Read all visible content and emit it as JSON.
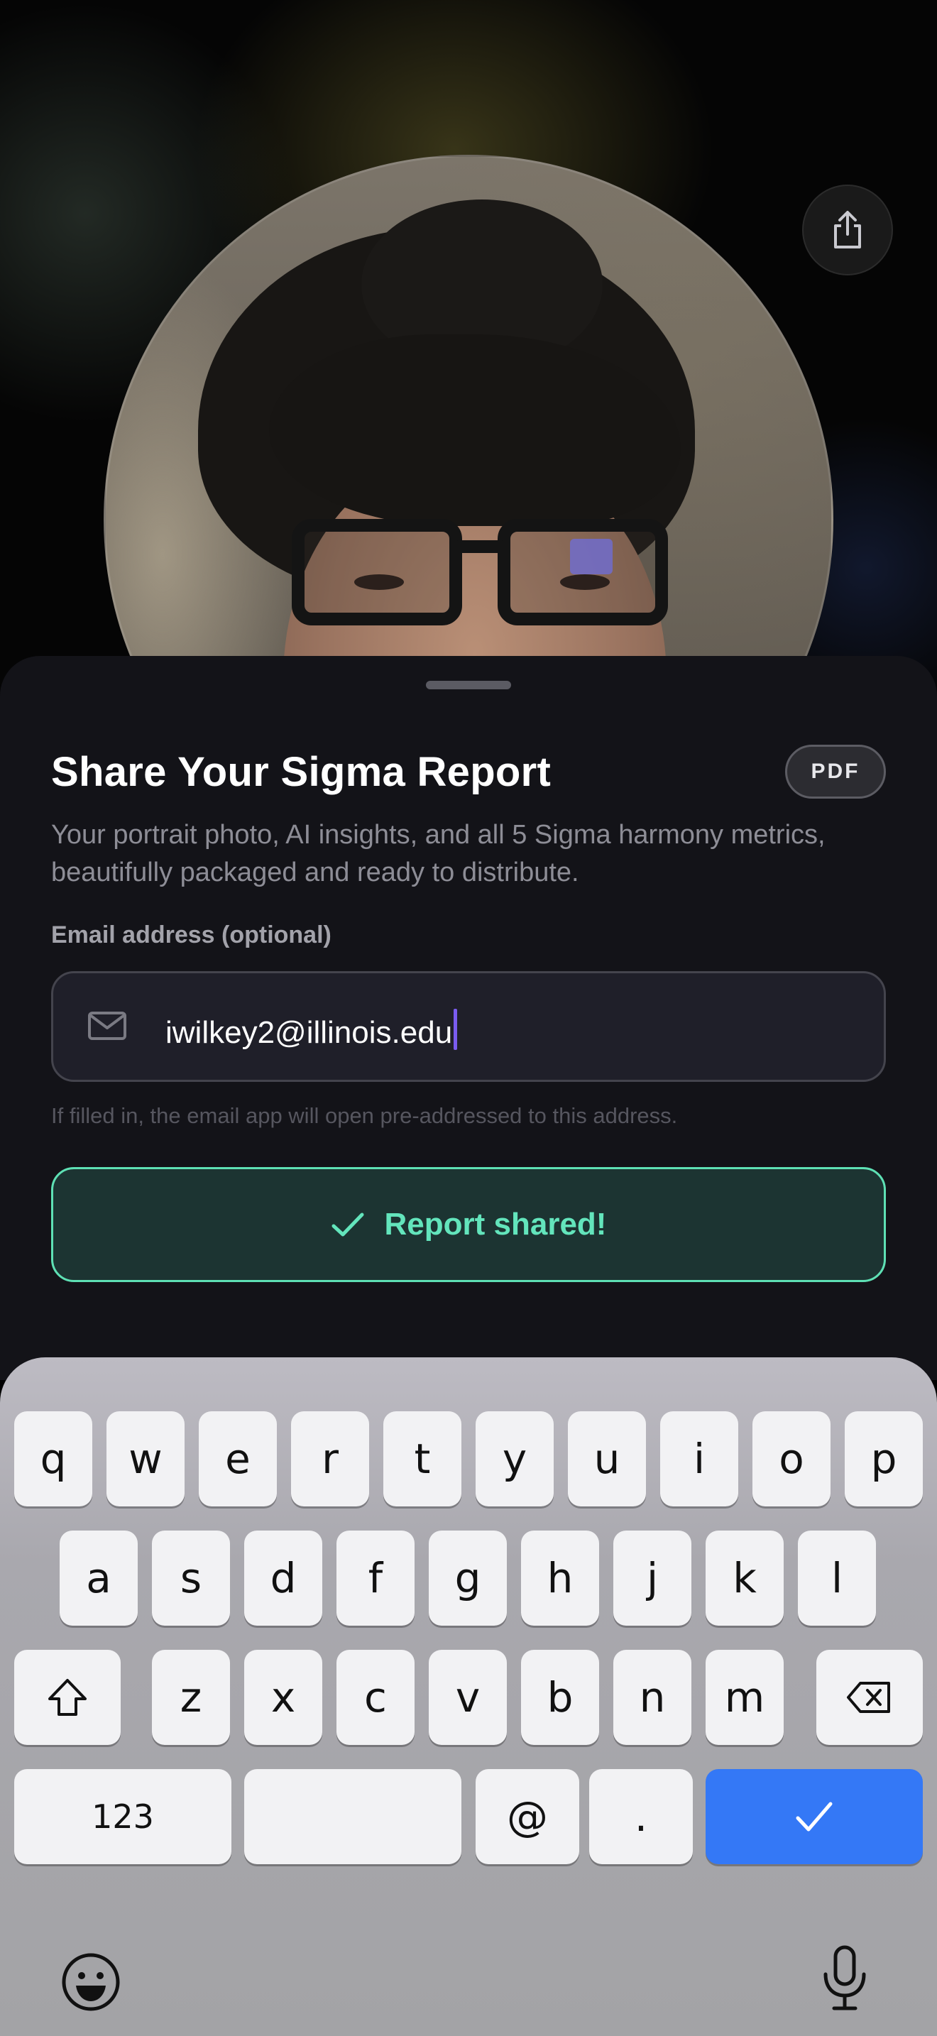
{
  "share_icon": "share-icon",
  "sheet": {
    "title": "Share Your Sigma Report",
    "badge": "PDF",
    "description": "Your portrait photo, AI insights, and all 5 Sigma harmony metrics, beautifully packaged and ready to distribute.",
    "email_label": "Email address (optional)",
    "email_value": "iwilkey2@illinois.edu",
    "hint": "If filled in, the email app will open pre-addressed to this address.",
    "shared_button_label": "Report shared!"
  },
  "keyboard": {
    "row1": [
      "q",
      "w",
      "e",
      "r",
      "t",
      "y",
      "u",
      "i",
      "o",
      "p"
    ],
    "row2": [
      "a",
      "s",
      "d",
      "f",
      "g",
      "h",
      "j",
      "k",
      "l"
    ],
    "row3": [
      "z",
      "x",
      "c",
      "v",
      "b",
      "n",
      "m"
    ],
    "numbers_key": "123",
    "at_key": "@",
    "dot_key": ".",
    "space_key": ""
  },
  "colors": {
    "accent_success": "#63e5bc",
    "caret": "#7a5cf0",
    "return_key": "#3478f6"
  }
}
